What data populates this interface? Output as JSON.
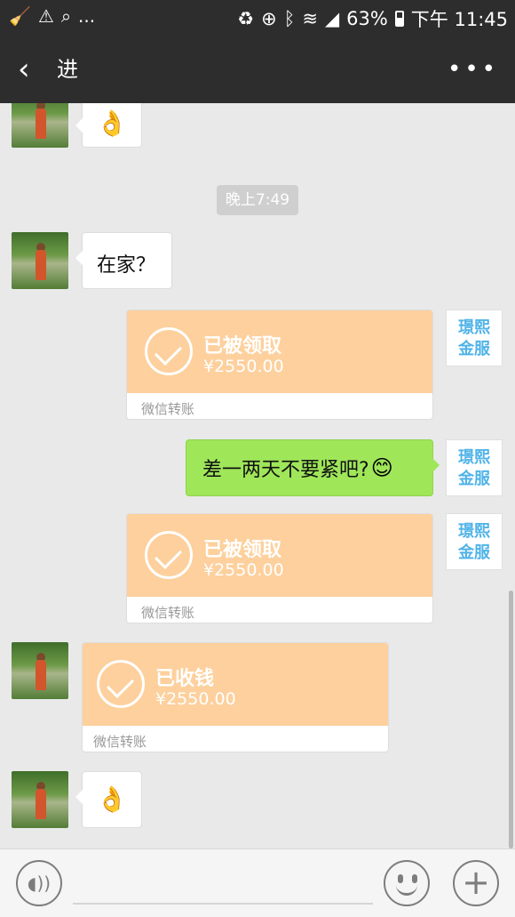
{
  "status_bar": {
    "left_icons": [
      "broom-icon",
      "alert-icon",
      "search-icon"
    ],
    "left_more": "...",
    "battery_percent": "63%",
    "time": "下午 11:45"
  },
  "header": {
    "title": "进",
    "back_icon": "chevron-left-icon",
    "more_icon": "more-icon"
  },
  "chat": {
    "time_separator": "晚上7:49",
    "messages": [
      {
        "side": "left",
        "type": "emoji",
        "icon": "ok-hand-icon",
        "emoji": "👌"
      },
      {
        "side": "left",
        "type": "text",
        "text": "在家？"
      },
      {
        "side": "right",
        "type": "transfer",
        "status": "已被领取",
        "amount": "¥2550.00",
        "footer": "微信转账"
      },
      {
        "side": "right",
        "type": "text",
        "text": "差一两天不要紧吧?",
        "emoji": "😊"
      },
      {
        "side": "right",
        "type": "transfer",
        "status": "已被领取",
        "amount": "¥2550.00",
        "footer": "微信转账"
      },
      {
        "side": "left",
        "type": "transfer",
        "status": "已收钱",
        "amount": "¥2550.00",
        "footer": "微信转账"
      },
      {
        "side": "left",
        "type": "emoji",
        "icon": "ok-hand-icon",
        "emoji": "👌"
      }
    ],
    "right_avatar_text_line1": "璟熙",
    "right_avatar_text_line2": "金服"
  },
  "bottom_bar": {
    "voice_icon": "voice-icon",
    "emoji_icon": "smile-icon",
    "plus_icon": "plus-icon"
  },
  "colors": {
    "header_bg": "#2d2d2d",
    "chat_bg": "#e9e9e9",
    "transfer_orange": "#fdd09d",
    "green_bubble": "#9fe659",
    "right_avatar_text": "#4fb3e8"
  }
}
